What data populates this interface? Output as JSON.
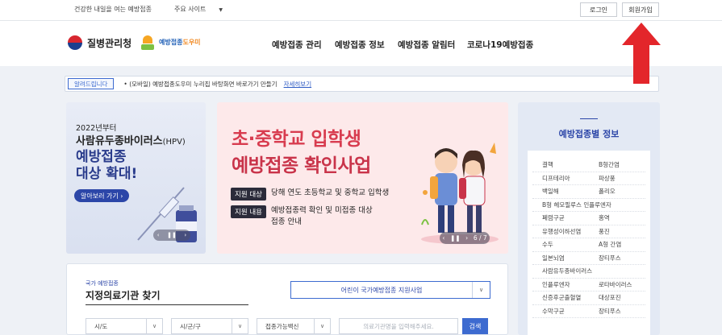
{
  "topbar": {
    "tagline": "건강한 내일을 여는 예방접종",
    "main_sites": "주요 사이트",
    "main_sites_caret": "▼",
    "login": "로그인",
    "join": "회원가입"
  },
  "header": {
    "agency_name": "질병관리청",
    "helper_logo": "예방접종",
    "helper_logo_accent": "도우미",
    "nav": [
      "예방접종 관리",
      "예방접종 정보",
      "예방접종 알림터",
      "코로나19예방접종"
    ]
  },
  "notice": {
    "tag": "알려드립니다",
    "message": "• (모바일) 예방접종도우미 누리집 바탕화면 바로가기 만들기",
    "link": "자세히보기"
  },
  "banner_left": {
    "line1": "2022년부터",
    "line2": "사람유두종바이러스",
    "line2_small": "(HPV)",
    "line3a": "예방접종",
    "line3b": "대상 확대!",
    "cta": "알아보러 가기 ›",
    "pager_prev": "‹",
    "pager_pause": "❚❚",
    "pager_next": "›"
  },
  "banner_center": {
    "headline1": "초·중학교 입학생",
    "headline2": "예방접종 확인사업",
    "row1_badge": "지원 대상",
    "row1_text": "당해 연도 초등학교 및 중학교 입학생",
    "row2_badge": "지원 내용",
    "row2_text_a": "예방접종력 확인 및 미접종 대상",
    "row2_text_b": "접종 안내",
    "pager_prev": "‹",
    "pager_pause": "❚❚",
    "pager_next": "›",
    "pager_count": "6 / 7"
  },
  "info_panel": {
    "title": "예방접종별 정보",
    "rows": [
      [
        "결핵",
        "B형간염"
      ],
      [
        "디프테리아",
        "파상풍"
      ],
      [
        "백일해",
        "폴리오"
      ],
      [
        "B형 헤모필루스 인플루엔자",
        ""
      ],
      [
        "폐렴구균",
        "홍역"
      ],
      [
        "유행성이하선염",
        "풍진"
      ],
      [
        "수두",
        "A형 간염"
      ],
      [
        "일본뇌염",
        "장티푸스"
      ],
      [
        "사람유두종바이러스",
        ""
      ],
      [
        "인플루엔자",
        "로타바이러스"
      ],
      [
        "신증후군출혈열",
        "대상포진"
      ],
      [
        "수막구균",
        "장티푸스"
      ]
    ]
  },
  "search": {
    "small_title": "국가 예방접종",
    "title": "지정의료기관 찾기",
    "program_select": "어린이 국가예방접종 지원사업",
    "sido": "시/도",
    "sigungu": "시/군/구",
    "vaccine": "접종가능백신",
    "placeholder": "의료기관명을 입력해주세요.",
    "button": "검색",
    "dd_arrow": "∨"
  },
  "colors": {
    "accent": "#2c46a8",
    "highlight_red": "#e3262b",
    "banner_pink": "#fde9ea"
  }
}
